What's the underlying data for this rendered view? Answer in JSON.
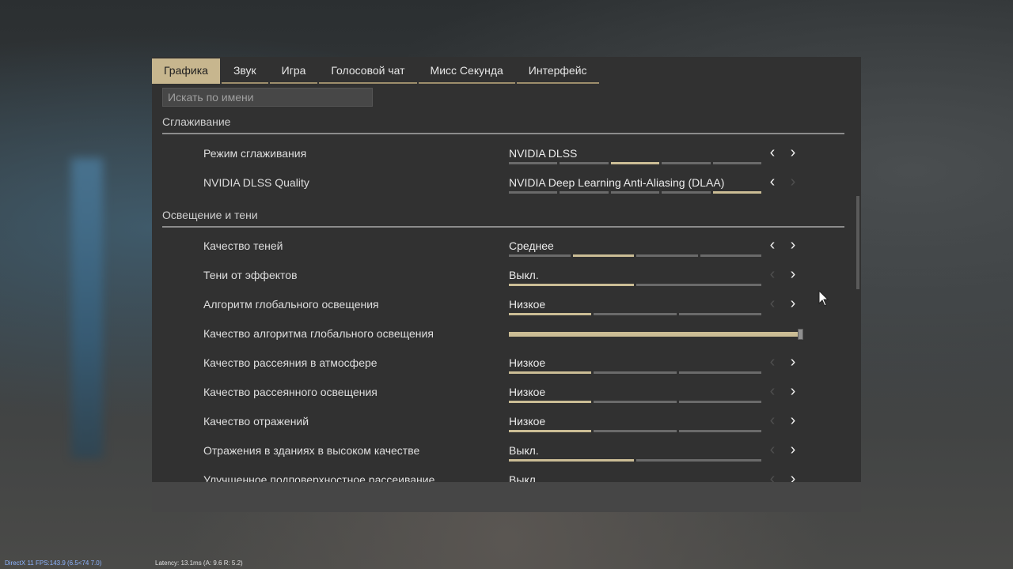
{
  "tabs": [
    {
      "label": "Графика",
      "active": true
    },
    {
      "label": "Звук",
      "active": false
    },
    {
      "label": "Игра",
      "active": false
    },
    {
      "label": "Голосовой чат",
      "active": false
    },
    {
      "label": "Мисс Секунда",
      "active": false
    },
    {
      "label": "Интерфейс",
      "active": false
    }
  ],
  "search": {
    "placeholder": "Искать по имени",
    "value": ""
  },
  "sections": {
    "antialiasing": {
      "title": "Сглаживание",
      "rows": [
        {
          "label": "Режим сглаживания",
          "value": "NVIDIA DLSS",
          "segments": 5,
          "selected": 3,
          "left_enabled": true,
          "right_enabled": true
        },
        {
          "label": "NVIDIA DLSS Quality",
          "value": "NVIDIA Deep Learning Anti-Aliasing (DLAA)",
          "segments": 5,
          "selected": 5,
          "left_enabled": true,
          "right_enabled": false
        }
      ]
    },
    "lighting": {
      "title": "Освещение и тени",
      "rows": [
        {
          "label": "Качество теней",
          "value": "Среднее",
          "segments": 4,
          "selected": 2,
          "left_enabled": true,
          "right_enabled": true
        },
        {
          "label": "Тени от эффектов",
          "value": "Выкл.",
          "segments": 2,
          "selected": 1,
          "left_enabled": false,
          "right_enabled": true
        },
        {
          "label": "Алгоритм глобального освещения",
          "value": "Низкое",
          "segments": 3,
          "selected": 1,
          "left_enabled": false,
          "right_enabled": true
        },
        {
          "label": "Качество алгоритма глобального освещения",
          "slider": 1.0
        },
        {
          "label": "Качество рассеяния в атмосфере",
          "value": "Низкое",
          "segments": 3,
          "selected": 1,
          "left_enabled": false,
          "right_enabled": true
        },
        {
          "label": "Качество рассеянного освещения",
          "value": "Низкое",
          "segments": 3,
          "selected": 1,
          "left_enabled": false,
          "right_enabled": true
        },
        {
          "label": "Качество отражений",
          "value": "Низкое",
          "segments": 3,
          "selected": 1,
          "left_enabled": false,
          "right_enabled": true
        },
        {
          "label": "Отражения в зданиях в высоком качестве",
          "value": "Выкл.",
          "segments": 2,
          "selected": 1,
          "left_enabled": false,
          "right_enabled": true
        },
        {
          "label": "Улучшенное подповерхностное рассеивание",
          "value": "Выкл.",
          "segments": 2,
          "selected": 1,
          "left_enabled": false,
          "right_enabled": true
        }
      ]
    }
  },
  "hud": {
    "fps": "DirectX 11 FPS:143.9 (6.5<74 7.0)",
    "latency": "Latency: 13.1ms (A: 9.6 R: 5.2)"
  },
  "colors": {
    "accent": "#c7b68e",
    "panel": "#313131",
    "segment_on": "#cbbd95",
    "segment_off": "#6a6a6a"
  }
}
